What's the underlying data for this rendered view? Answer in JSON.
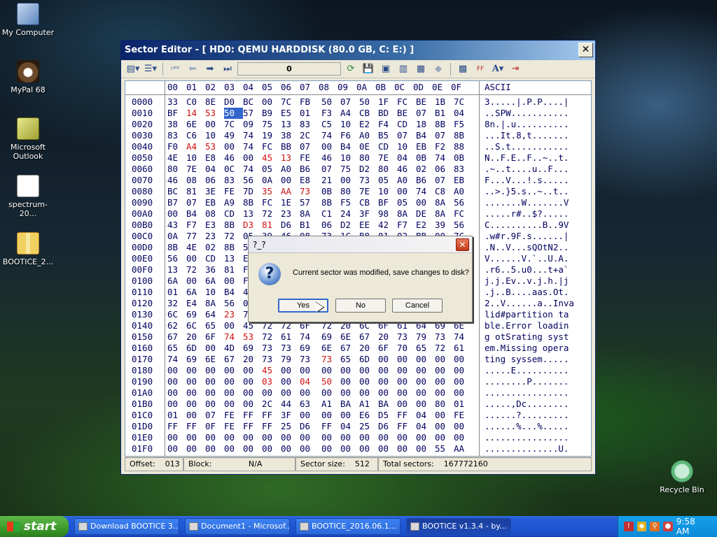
{
  "desktop": {
    "icons": [
      {
        "label": "My Computer",
        "icon": "computer-icon"
      },
      {
        "label": "MyPal 68",
        "icon": "browser-icon"
      },
      {
        "label": "Microsoft Outlook",
        "icon": "outlook-icon"
      },
      {
        "label": "spectrum-20...",
        "icon": "document-icon"
      },
      {
        "label": "BOOTICE_2...",
        "icon": "zip-folder-icon"
      },
      {
        "label": "Recycle Bin",
        "icon": "recycle-bin-icon"
      }
    ]
  },
  "window": {
    "title": "Sector Editor - [ HD0: QEMU HARDDISK (80.0 GB, C: E:) ]",
    "close_glyph": "✕",
    "toolbar": {
      "sector_field": "0"
    },
    "header": {
      "hex_cols": [
        "00",
        "01",
        "02",
        "03",
        "04",
        "05",
        "06",
        "07",
        "08",
        "09",
        "0A",
        "0B",
        "0C",
        "0D",
        "0E",
        "0F"
      ],
      "ascii_label": "ASCII"
    },
    "rows": [
      {
        "off": "0000",
        "hex": "33 C0 8E D0 BC 00 7C FB 50 07 50 1F FC BE 1B 7C",
        "ascii": "3.....|.P.P....|"
      },
      {
        "off": "0010",
        "hex": "BF 14 53 50 57 B9 E5 01 F3 A4 CB BD BE 07 B1 04",
        "ascii": "..SPW..........."
      },
      {
        "off": "0020",
        "hex": "38 6E 00 7C 09 75 13 83 C5 10 E2 F4 CD 18 8B F5",
        "ascii": "8n.|.u.........."
      },
      {
        "off": "0030",
        "hex": "83 C6 10 49 74 19 38 2C 74 F6 A0 B5 07 B4 07 8B",
        "ascii": "...It.8,t......."
      },
      {
        "off": "0040",
        "hex": "F0 A4 53 00 74 FC BB 07 00 B4 0E CD 10 EB F2 88",
        "ascii": "..S.t..........."
      },
      {
        "off": "0050",
        "hex": "4E 10 E8 46 00 45 13 FE 46 10 80 7E 04 0B 74 0B",
        "ascii": "N..F.E..F..~..t."
      },
      {
        "off": "0060",
        "hex": "80 7E 04 0C 74 05 A0 B6 07 75 D2 80 46 02 06 83",
        "ascii": ".~..t....u..F..."
      },
      {
        "off": "0070",
        "hex": "46 08 06 83 56 0A 00 E8 21 00 73 05 A0 B6 07 EB",
        "ascii": "F...V...!.s....."
      },
      {
        "off": "0080",
        "hex": "BC 81 3E FE 7D 35 AA 73 0B 80 7E 10 00 74 C8 A0",
        "ascii": "..>.}5.s..~..t.."
      },
      {
        "off": "0090",
        "hex": "B7 07 EB A9 8B FC 1E 57 8B F5 CB BF 05 00 8A 56",
        "ascii": ".......W.......V"
      },
      {
        "off": "00A0",
        "hex": "00 B4 08 CD 13 72 23 8A C1 24 3F 98 8A DE 8A FC",
        "ascii": ".....r#..$?....."
      },
      {
        "off": "00B0",
        "hex": "43 F7 E3 8B D3 81 D6 B1 06 D2 EE 42 F7 E2 39 56",
        "ascii": "C..........B..9V"
      },
      {
        "off": "00C0",
        "hex": "0A 77 23 72 05 39 46 08 73 1C B8 01 02 BB 00 7C",
        "ascii": ".w#r.9F.s......|"
      },
      {
        "off": "00D0",
        "hex": "8B 4E 02 8B 56 00 CD 13 73 51 4F 74 4E 32 E4 8A",
        "ascii": ".N..V...sQOtN2.."
      },
      {
        "off": "00E0",
        "hex": "56 00 CD 13 EB E4 8A 56 00 60 BB AA 55 B4 41 CD",
        "ascii": "V......V.`..U.A."
      },
      {
        "off": "00F0",
        "hex": "13 72 36 81 FB 55 AA 75 30 F6 C1 01 74 2B 61 60",
        "ascii": ".r6..5.u0...t+a`"
      },
      {
        "off": "0100",
        "hex": "6A 00 6A 00 FF 76 0A FF 76 08 6A 00 68 00 7C 6A",
        "ascii": "j.j.Ev..v.j.h.|j"
      },
      {
        "off": "0110",
        "hex": "01 6A 10 B4 42 8B F4 CD 13 61 61 73 0E 4F 74 0B",
        "ascii": ".j..B....aas.Ot."
      },
      {
        "off": "0120",
        "hex": "32 E4 8A 56 00 CD 13 EB D6 61 F9 C3 49 6E 76 61",
        "ascii": "2..V......a..Inva"
      },
      {
        "off": "0130",
        "hex": "6C 69 64 23 70 61 72 74 69 74 69 6F 6E 20 74 61",
        "ascii": "lid#partition ta"
      },
      {
        "off": "0140",
        "hex": "62 6C 65 00 45 72 72 6F 72 20 6C 6F 61 64 69 6E",
        "ascii": "ble.Error loadin"
      },
      {
        "off": "0150",
        "hex": "67 20 6F 74 53 72 61 74 69 6E 67 20 73 79 73 74",
        "ascii": "g otSrating syst"
      },
      {
        "off": "0160",
        "hex": "65 6D 00 4D 69 73 73 69 6E 67 20 6F 70 65 72 61",
        "ascii": "em.Missing opera"
      },
      {
        "off": "0170",
        "hex": "74 69 6E 67 20 73 79 73 73 65 6D 00 00 00 00 00",
        "ascii": "ting syssem....."
      },
      {
        "off": "0180",
        "hex": "00 00 00 00 00 45 00 00 00 00 00 00 00 00 00 00",
        "ascii": ".....E.........."
      },
      {
        "off": "0190",
        "hex": "00 00 00 00 00 03 00 04 50 00 00 00 00 00 00 00",
        "ascii": "........P......."
      },
      {
        "off": "01A0",
        "hex": "00 00 00 00 00 00 00 00 00 00 00 00 00 00 00 00",
        "ascii": "................"
      },
      {
        "off": "01B0",
        "hex": "00 00 00 00 00 2C 44 63 A1 BA A1 BA 00 00 80 01",
        "ascii": ".....,Dc........"
      },
      {
        "off": "01C0",
        "hex": "01 00 07 FE FF FF 3F 00 00 00 E6 D5 FF 04 00 FE",
        "ascii": "......?........."
      },
      {
        "off": "01D0",
        "hex": "FF FF 0F FE FF FF 25 D6 FF 04 25 D6 FF 04 00 00",
        "ascii": "......%...%....."
      },
      {
        "off": "01E0",
        "hex": "00 00 00 00 00 00 00 00 00 00 00 00 00 00 00 00",
        "ascii": "................"
      },
      {
        "off": "01F0",
        "hex": "00 00 00 00 00 00 00 00 00 00 00 00 00 00 55 AA",
        "ascii": "..............U."
      }
    ],
    "status": {
      "offset_label": "Offset:",
      "offset_value": "013",
      "block_label": "Block:",
      "block_value": "N/A",
      "sector_size_label": "Sector size:",
      "sector_size_value": "512",
      "total_sectors_label": "Total sectors:",
      "total_sectors_value": "167772160"
    }
  },
  "dialog": {
    "title": "?_?",
    "message": "Current sector was modified, save changes to disk?",
    "buttons": {
      "yes": "Yes",
      "no": "No",
      "cancel": "Cancel"
    }
  },
  "taskbar": {
    "start_label": "start",
    "tasks": [
      "Download BOOTICE 3...",
      "Document1 - Microsof...",
      "BOOTICE_2016.06.1...",
      "BOOTICE v1.3.4 - by..."
    ],
    "clock": "9:58 AM"
  }
}
